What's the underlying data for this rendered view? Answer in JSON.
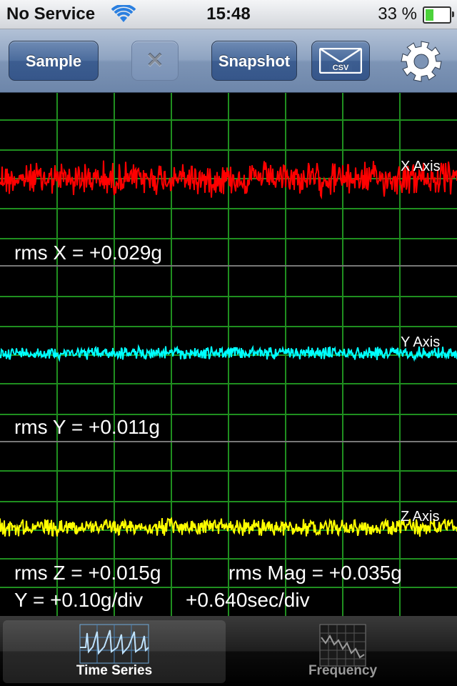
{
  "status_bar": {
    "carrier": "No Service",
    "time": "15:48",
    "battery": "33 %",
    "battery_level": 0.33
  },
  "toolbar": {
    "sample_label": "Sample",
    "clear_label": "✕",
    "snapshot_label": "Snapshot",
    "email_csv_label": "CSV"
  },
  "readouts": {
    "rms_x": "rms X = +0.029g",
    "rms_y": "rms Y = +0.011g",
    "rms_z": "rms Z = +0.015g",
    "rms_mag": "rms Mag = +0.035g",
    "y_scale": "Y = +0.10g/div",
    "x_scale": "+0.640sec/div"
  },
  "chart_data": {
    "type": "line",
    "series": [
      {
        "name": "X Axis",
        "color": "#ff0000",
        "rms": 0.029
      },
      {
        "name": "Y Axis",
        "color": "#00ffff",
        "rms": 0.011
      },
      {
        "name": "Z Axis",
        "color": "#ffff00",
        "rms": 0.015
      }
    ],
    "grid": true,
    "grid_color": "#1f8f1f",
    "y_per_div": 0.1,
    "sec_per_div": 0.64
  },
  "tabs": [
    {
      "label": "Time Series",
      "active": true
    },
    {
      "label": "Frequency",
      "active": false
    }
  ]
}
